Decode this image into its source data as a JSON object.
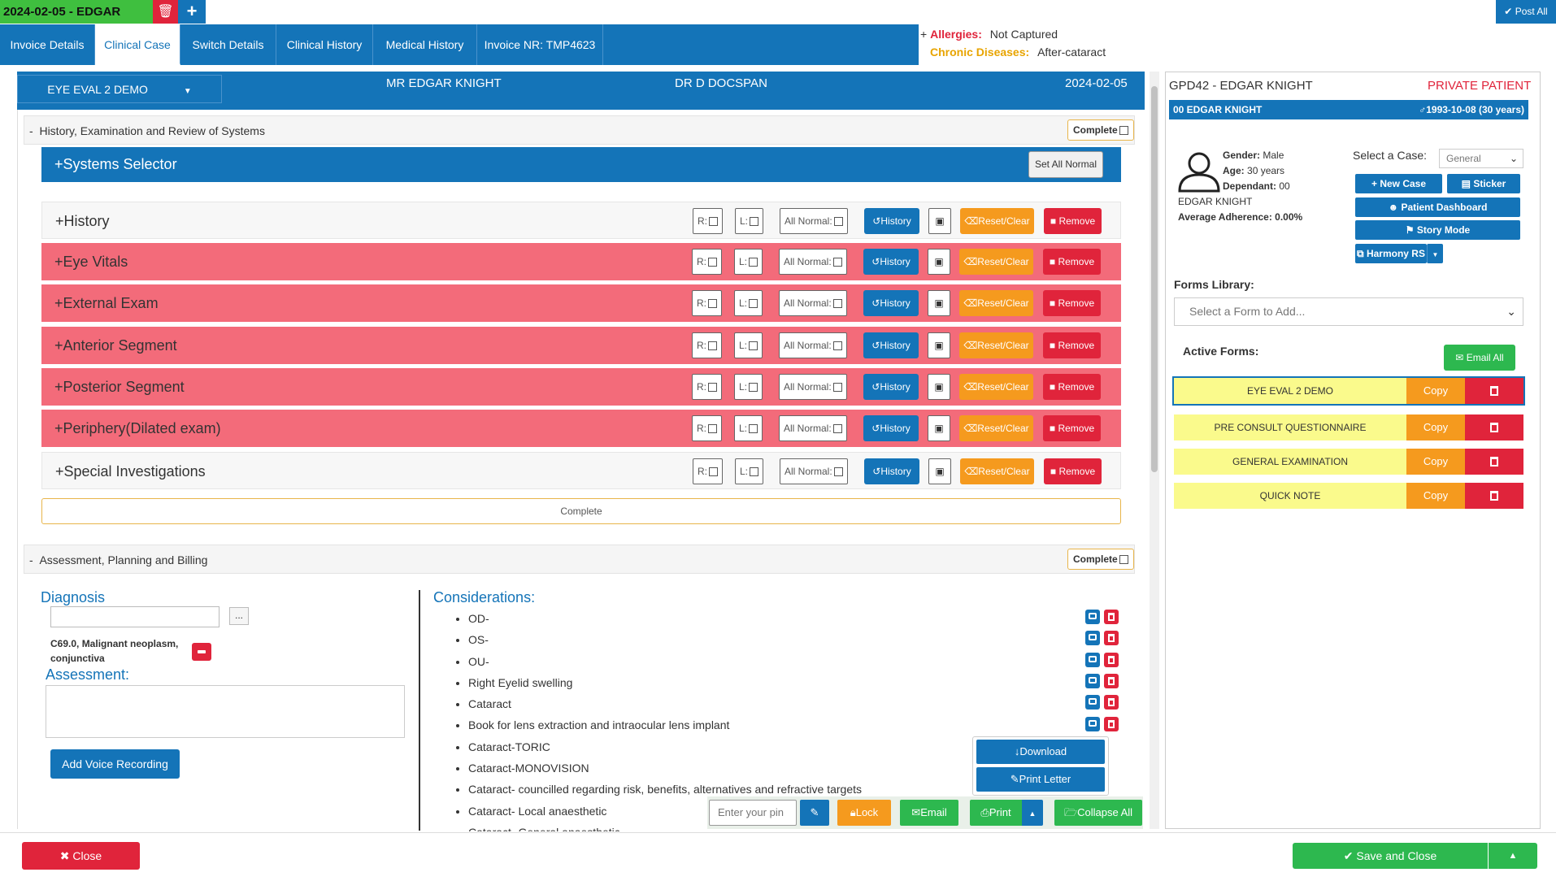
{
  "top": {
    "case_tab": "2024-02-05 - EDGAR",
    "post_all": "Post All"
  },
  "nav": {
    "tabs": [
      "Invoice Details",
      "Clinical Case",
      "Switch Details",
      "Clinical History",
      "Medical History",
      "Invoice NR: TMP4623"
    ],
    "active": "Clinical Case"
  },
  "info": {
    "allergies_label": "Allergies:",
    "allergies_value": "Not Captured",
    "chronic_label": "Chronic Diseases:",
    "chronic_value": "After-cataract"
  },
  "form_header": {
    "form_select": "EYE EVAL 2 DEMO",
    "patient": "MR EDGAR KNIGHT",
    "doctor": "DR D DOCSPAN",
    "date": "2024-02-05"
  },
  "section1": {
    "title": "History, Examination and Review of Systems",
    "complete": "Complete"
  },
  "systems_selector": {
    "title": "Systems Selector",
    "set_all_normal": "Set All Normal"
  },
  "systems": [
    {
      "name": "History",
      "style": "normal"
    },
    {
      "name": "Eye Vitals",
      "style": "red"
    },
    {
      "name": "External Exam",
      "style": "red"
    },
    {
      "name": "Anterior Segment",
      "style": "red"
    },
    {
      "name": "Posterior Segment",
      "style": "red"
    },
    {
      "name": "Periphery(Dilated exam)",
      "style": "red"
    },
    {
      "name": "Special Investigations",
      "style": "normal"
    }
  ],
  "row_controls": {
    "r": "R:",
    "l": "L:",
    "all_normal": "All Normal:",
    "history": "History",
    "reset": "Reset/Clear",
    "remove": "Remove"
  },
  "complete_wide": "Complete",
  "section2": {
    "title": "Assessment, Planning and Billing",
    "complete": "Complete"
  },
  "diagnosis": {
    "title": "Diagnosis",
    "item": "C69.0, Malignant neoplasm, conjunctiva",
    "dots": "..."
  },
  "assessment": {
    "title": "Assessment:",
    "voice": "Add Voice Recording"
  },
  "considerations": {
    "title": "Considerations:",
    "items": [
      "OD-",
      "OS-",
      "OU-",
      "Right Eyelid swelling",
      "Cataract",
      "Book for lens extraction and intraocular lens implant",
      "Cataract-TORIC",
      "Cataract-MONOVISION",
      "Cataract- councilled regarding risk, benefits, alternatives and refractive targets",
      "Cataract- Local anaesthetic",
      "Cataract- General anaesthetic"
    ]
  },
  "popup": {
    "download": "Download",
    "print_letter": "Print Letter"
  },
  "toolbar": {
    "pin_placeholder": "Enter your pin",
    "lock": "Lock",
    "email": "Email",
    "print": "Print",
    "collapse": "Collapse All"
  },
  "bottom": {
    "close": "Close",
    "save": "Save and Close"
  },
  "right": {
    "title": "GPD42 - EDGAR KNIGHT",
    "private": "PRIVATE PATIENT",
    "bar_left": "00 EDGAR KNIGHT",
    "bar_right": "1993-10-08 (30 years)",
    "gender_label": "Gender:",
    "gender": "Male",
    "age_label": "Age:",
    "age": "30 years",
    "dependant_label": "Dependant:",
    "dependant": "00",
    "name": "EDGAR KNIGHT",
    "adherence": "Average Adherence: 0.00%",
    "select_case_label": "Select a Case:",
    "select_case_value": "General",
    "new_case": "New Case",
    "sticker": "Sticker",
    "dashboard": "Patient Dashboard",
    "story": "Story Mode",
    "harmony": "Harmony RS",
    "forms_library": "Forms Library:",
    "forms_placeholder": "Select a Form to Add...",
    "active_forms": "Active Forms:",
    "email_all": "Email All",
    "forms": [
      "EYE EVAL 2 DEMO",
      "PRE CONSULT QUESTIONNAIRE",
      "GENERAL EXAMINATION",
      "QUICK NOTE"
    ],
    "copy": "Copy"
  },
  "colors": {
    "primary": "#1474b8",
    "danger": "#e0243b",
    "warning": "#f59a1e",
    "success": "#2db84f",
    "row_red": "#f36b7a",
    "form_yellow": "#fafa8c"
  }
}
